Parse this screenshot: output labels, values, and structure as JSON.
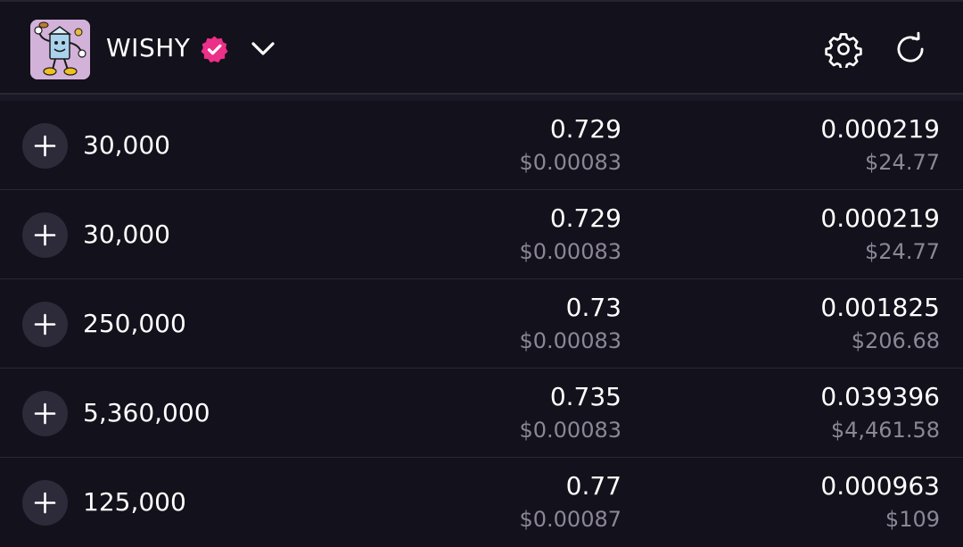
{
  "header": {
    "token_name": "WISHY",
    "icons": {
      "avatar": "token-avatar",
      "verified": "verified-badge-icon",
      "dropdown": "chevron-down-icon",
      "settings": "gear-icon",
      "refresh": "refresh-icon"
    }
  },
  "colors": {
    "background": "#13111b",
    "verified_badge": "#ec2f88",
    "muted_text": "#8b8796",
    "plus_button": "#2d2a3a"
  },
  "orders": [
    {
      "amount": "30,000",
      "price": "0.729",
      "price_usd": "$0.00083",
      "total": "0.000219",
      "total_usd": "$24.77"
    },
    {
      "amount": "30,000",
      "price": "0.729",
      "price_usd": "$0.00083",
      "total": "0.000219",
      "total_usd": "$24.77"
    },
    {
      "amount": "250,000",
      "price": "0.73",
      "price_usd": "$0.00083",
      "total": "0.001825",
      "total_usd": "$206.68"
    },
    {
      "amount": "5,360,000",
      "price": "0.735",
      "price_usd": "$0.00083",
      "total": "0.039396",
      "total_usd": "$4,461.58"
    },
    {
      "amount": "125,000",
      "price": "0.77",
      "price_usd": "$0.00087",
      "total": "0.000963",
      "total_usd": "$109"
    }
  ]
}
